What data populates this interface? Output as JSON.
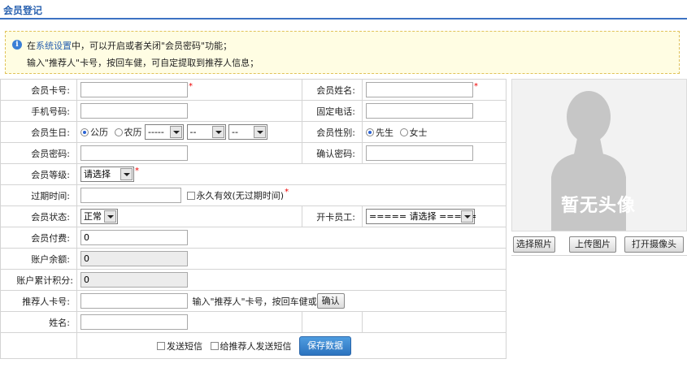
{
  "page": {
    "title": "会员登记"
  },
  "notice": {
    "line1_pre": "在",
    "line1_link": "系统设置",
    "line1_post": "中，可以开启或者关闭\"会员密码\"功能；",
    "line2": "输入\"推荐人\"卡号，按回车健，可自定提取到推荐人信息；"
  },
  "form": {
    "card_no": {
      "label": "会员卡号:",
      "value": ""
    },
    "name": {
      "label": "会员姓名:",
      "value": ""
    },
    "mobile": {
      "label": "手机号码:",
      "value": ""
    },
    "phone": {
      "label": "固定电话:",
      "value": ""
    },
    "birthday": {
      "label": "会员生日:",
      "solar_label": "公历",
      "lunar_label": "农历",
      "selected": "公历",
      "year": "-----",
      "month": "--",
      "day": "--"
    },
    "gender": {
      "label": "会员性别:",
      "male": "先生",
      "female": "女士",
      "selected": "先生"
    },
    "password": {
      "label": "会员密码:",
      "value": ""
    },
    "confirm_password": {
      "label": "确认密码:",
      "value": ""
    },
    "level": {
      "label": "会员等级:",
      "value": "请选择"
    },
    "expire": {
      "label": "过期时间:",
      "value": "",
      "forever_label": "永久有效(无过期时间)",
      "forever_checked": false
    },
    "status": {
      "label": "会员状态:",
      "value": "正常"
    },
    "staff": {
      "label": "开卡员工:",
      "value": "===== 请选择 ====="
    },
    "payment": {
      "label": "会员付费:",
      "value": "0"
    },
    "balance": {
      "label": "账户余额:",
      "value": "0"
    },
    "points": {
      "label": "账户累计积分:",
      "value": "0"
    },
    "referrer": {
      "label": "推荐人卡号:",
      "value": "",
      "hint": "输入\"推荐人\"卡号，按回车健或",
      "confirm_label": "确认"
    },
    "referrer_name": {
      "label": "姓名:",
      "value": ""
    }
  },
  "footer": {
    "send_sms_label": "发送短信",
    "send_sms_checked": false,
    "send_referrer_sms_label": "给推荐人发送短信",
    "send_referrer_sms_checked": false,
    "save_label": "保存数据"
  },
  "photo": {
    "placeholder_text": "暂无头像",
    "select_label": "选择照片",
    "upload_label": "上传图片",
    "camera_label": "打开摄像头"
  },
  "colors": {
    "accent": "#3d72c3",
    "title": "#2a62b0",
    "notice_bg": "#fffde3",
    "save_button": "#2c73bf",
    "required": "#ee0000"
  }
}
